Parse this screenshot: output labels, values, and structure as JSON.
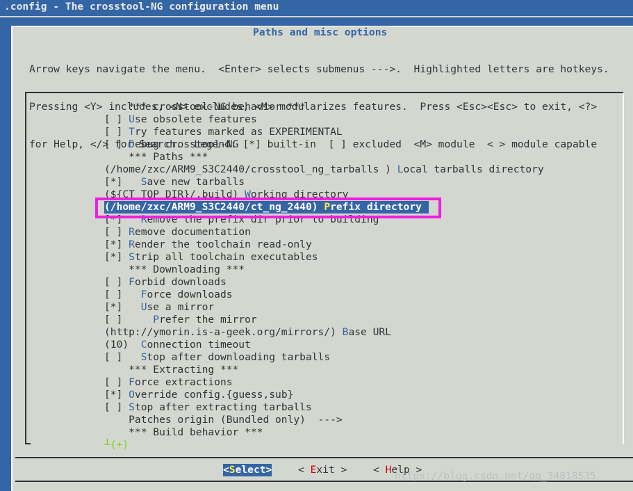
{
  "window": {
    "title": ".config - The crosstool-NG configuration menu"
  },
  "dialog": {
    "title": "Paths and misc options",
    "help_lines": [
      "Arrow keys navigate the menu.  <Enter> selects submenus --->.  Highlighted letters are hotkeys.",
      "Pressing <Y> includes, <N> excludes, <M> modularizes features.  Press <Esc><Esc> to exit, <?>",
      "for Help, </> for Search.  Legend: [*] built-in  [ ] excluded  <M> module  < > module capable"
    ]
  },
  "menu": {
    "items": [
      {
        "prefix": "    *** crosstool-NG behavior ***",
        "hotkey": "",
        "rest": ""
      },
      {
        "prefix": "[ ] ",
        "hotkey": "U",
        "rest": "se obsolete features"
      },
      {
        "prefix": "[ ] ",
        "hotkey": "T",
        "rest": "ry features marked as EXPERIMENTAL"
      },
      {
        "prefix": "[ ] ",
        "hotkey": "D",
        "rest": "ebug crosstool-NG"
      },
      {
        "prefix": "    *** Paths ***",
        "hotkey": "",
        "rest": ""
      },
      {
        "prefix": "(/home/zxc/ARM9_S3C2440/crosstool_ng_tarballs ) ",
        "hotkey": "L",
        "rest": "ocal tarballs directory"
      },
      {
        "prefix": "[*]   ",
        "hotkey": "S",
        "rest": "ave new tarballs"
      },
      {
        "prefix": "(${CT_TOP_DIR}/.build) ",
        "hotkey": "W",
        "rest": "orking directory"
      },
      {
        "prefix": "(/home/zxc/ARM9_S3C2440/ct_ng_2440) ",
        "hotkey": "P",
        "rest": "refix directory",
        "selected": true
      },
      {
        "prefix": "[*]   ",
        "hotkey": "R",
        "rest": "emove the prefix dir prior to building"
      },
      {
        "prefix": "[ ] ",
        "hotkey": "R",
        "rest": "emove documentation"
      },
      {
        "prefix": "[*] ",
        "hotkey": "R",
        "rest": "ender the toolchain read-only"
      },
      {
        "prefix": "[*] ",
        "hotkey": "S",
        "rest": "trip all toolchain executables"
      },
      {
        "prefix": "    *** Downloading ***",
        "hotkey": "",
        "rest": ""
      },
      {
        "prefix": "[ ] ",
        "hotkey": "F",
        "rest": "orbid downloads"
      },
      {
        "prefix": "[ ]   ",
        "hotkey": "F",
        "rest": "orce downloads"
      },
      {
        "prefix": "[*]   ",
        "hotkey": "U",
        "rest": "se a mirror"
      },
      {
        "prefix": "[ ]     ",
        "hotkey": "P",
        "rest": "refer the mirror"
      },
      {
        "prefix": "(http://ymorin.is-a-geek.org/mirrors/) ",
        "hotkey": "B",
        "rest": "ase URL"
      },
      {
        "prefix": "(10)  ",
        "hotkey": "C",
        "rest": "onnection timeout"
      },
      {
        "prefix": "[ ]   ",
        "hotkey": "S",
        "rest": "top after downloading tarballs"
      },
      {
        "prefix": "    *** Extracting ***",
        "hotkey": "",
        "rest": ""
      },
      {
        "prefix": "[ ] ",
        "hotkey": "F",
        "rest": "orce extractions"
      },
      {
        "prefix": "[*] ",
        "hotkey": "O",
        "rest": "verride config.{guess,sub}"
      },
      {
        "prefix": "[ ] ",
        "hotkey": "S",
        "rest": "top after extracting tarballs"
      },
      {
        "prefix": "    Patches origin (Bundled only)  --->",
        "hotkey": "",
        "rest": ""
      },
      {
        "prefix": "    *** Build behavior ***",
        "hotkey": "",
        "rest": ""
      }
    ],
    "more_indicator": "┴(+)"
  },
  "buttons": {
    "select": {
      "open": "<",
      "hotkey": "S",
      "rest": "elect>"
    },
    "exit": {
      "open": "< ",
      "hotkey": "E",
      "rest": "xit >"
    },
    "help": {
      "open": "< ",
      "hotkey": "H",
      "rest": "elp >"
    }
  },
  "watermark": "https://blog.csdn.net/qq_34818535",
  "colors": {
    "background": "#3465a4",
    "dialog": "#d3d7cf",
    "selection": "#3465a4",
    "hotkey": "#3465a4",
    "selected_hotkey": "#fce94f",
    "annotation_outline": "#f01ee0"
  }
}
